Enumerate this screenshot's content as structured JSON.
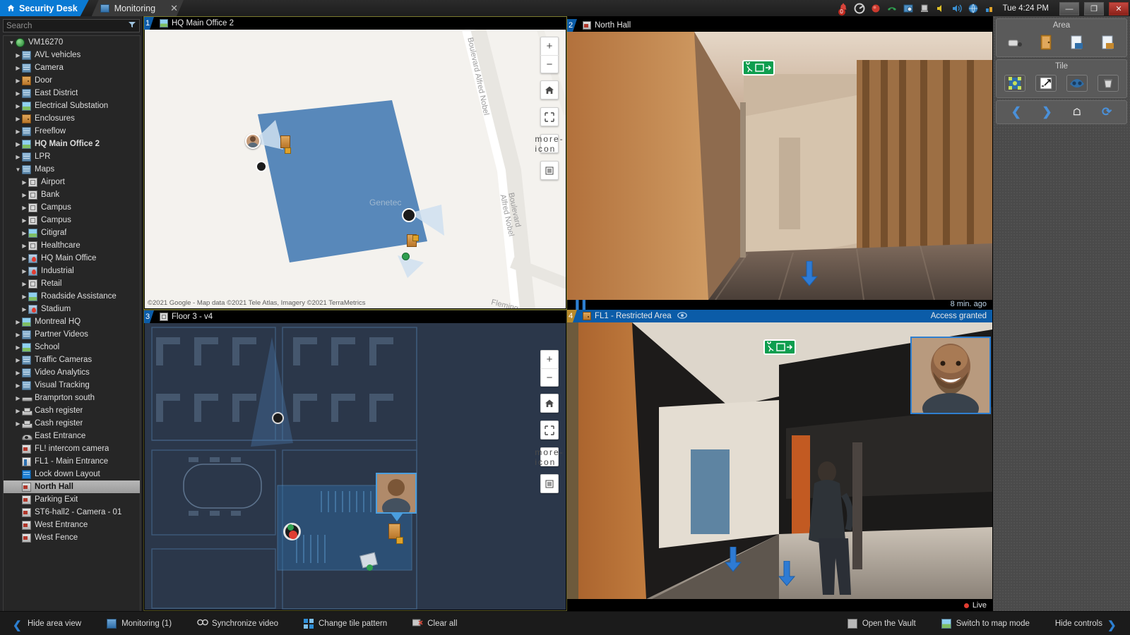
{
  "titlebar": {
    "app_tab": {
      "label": "Security Desk",
      "icon": "home-icon"
    },
    "doc_tab": {
      "label": "Monitoring",
      "icon": "monitoring-icon",
      "close": "✕"
    },
    "tray_icons": [
      "alarm-bell-icon",
      "genetec-logo-icon",
      "record-icon",
      "phone-icon",
      "task-icon",
      "hardware-icon",
      "mute-icon",
      "volume-icon",
      "network-globe-icon",
      "stats-icon"
    ],
    "alarm_count": "0",
    "clock": "Tue 4:24 PM",
    "window_buttons": {
      "minimize": "—",
      "restore": "❐",
      "close": "✕"
    }
  },
  "sidebar": {
    "search": {
      "placeholder": "Search",
      "value": "",
      "filter_icon": "filter-icon"
    },
    "tree": [
      {
        "label": "VM16270",
        "depth": 0,
        "arrow": "down",
        "icon": "vm-globe-icon",
        "bold": false,
        "selected": false
      },
      {
        "label": "AVL vehicles",
        "depth": 1,
        "arrow": "right",
        "icon": "ic-server",
        "bold": false,
        "selected": false
      },
      {
        "label": "Camera",
        "depth": 1,
        "arrow": "right",
        "icon": "ic-server",
        "bold": false,
        "selected": false
      },
      {
        "label": "Door",
        "depth": 1,
        "arrow": "right",
        "icon": "ic-door",
        "bold": false,
        "selected": false
      },
      {
        "label": "East District",
        "depth": 1,
        "arrow": "right",
        "icon": "ic-server",
        "bold": false,
        "selected": false
      },
      {
        "label": "Electrical Substation",
        "depth": 1,
        "arrow": "right",
        "icon": "ic-map",
        "bold": false,
        "selected": false
      },
      {
        "label": "Enclosures",
        "depth": 1,
        "arrow": "right",
        "icon": "ic-door",
        "bold": false,
        "selected": false
      },
      {
        "label": "Freeflow",
        "depth": 1,
        "arrow": "right",
        "icon": "ic-server",
        "bold": false,
        "selected": false
      },
      {
        "label": "HQ Main Office 2",
        "depth": 1,
        "arrow": "right",
        "icon": "ic-map",
        "bold": true,
        "selected": false
      },
      {
        "label": "LPR",
        "depth": 1,
        "arrow": "right",
        "icon": "ic-server",
        "bold": false,
        "selected": false
      },
      {
        "label": "Maps",
        "depth": 1,
        "arrow": "down",
        "icon": "ic-server",
        "bold": false,
        "selected": false
      },
      {
        "label": "Airport",
        "depth": 2,
        "arrow": "right",
        "icon": "ic-plan",
        "bold": false,
        "selected": false
      },
      {
        "label": "Bank",
        "depth": 2,
        "arrow": "right",
        "icon": "ic-plan",
        "bold": false,
        "selected": false
      },
      {
        "label": "Campus",
        "depth": 2,
        "arrow": "right",
        "icon": "ic-plan",
        "bold": false,
        "selected": false
      },
      {
        "label": "Campus",
        "depth": 2,
        "arrow": "right",
        "icon": "ic-plan",
        "bold": false,
        "selected": false
      },
      {
        "label": "Citigraf",
        "depth": 2,
        "arrow": "right",
        "icon": "ic-map",
        "bold": false,
        "selected": false
      },
      {
        "label": "Healthcare",
        "depth": 2,
        "arrow": "right",
        "icon": "ic-plan",
        "bold": false,
        "selected": false
      },
      {
        "label": "HQ Main Office",
        "depth": 2,
        "arrow": "right",
        "icon": "ic-mappin",
        "bold": false,
        "selected": false
      },
      {
        "label": "Industrial",
        "depth": 2,
        "arrow": "right",
        "icon": "ic-mappin",
        "bold": false,
        "selected": false
      },
      {
        "label": "Retail",
        "depth": 2,
        "arrow": "right",
        "icon": "ic-plan",
        "bold": false,
        "selected": false
      },
      {
        "label": "Roadside Assistance",
        "depth": 2,
        "arrow": "right",
        "icon": "ic-map",
        "bold": false,
        "selected": false
      },
      {
        "label": "Stadium",
        "depth": 2,
        "arrow": "right",
        "icon": "ic-mappin",
        "bold": false,
        "selected": false
      },
      {
        "label": "Montreal HQ",
        "depth": 1,
        "arrow": "right",
        "icon": "ic-map",
        "bold": false,
        "selected": false
      },
      {
        "label": "Partner Videos",
        "depth": 1,
        "arrow": "right",
        "icon": "ic-server",
        "bold": false,
        "selected": false
      },
      {
        "label": "School",
        "depth": 1,
        "arrow": "right",
        "icon": "ic-map",
        "bold": false,
        "selected": false
      },
      {
        "label": "Traffic Cameras",
        "depth": 1,
        "arrow": "right",
        "icon": "ic-server",
        "bold": false,
        "selected": false
      },
      {
        "label": "Video Analytics",
        "depth": 1,
        "arrow": "right",
        "icon": "ic-server",
        "bold": false,
        "selected": false
      },
      {
        "label": "Visual Tracking",
        "depth": 1,
        "arrow": "right",
        "icon": "ic-server",
        "bold": false,
        "selected": false
      },
      {
        "label": "Bramprton south",
        "depth": 1,
        "arrow": "right",
        "icon": "ic-lpr",
        "bold": false,
        "selected": false
      },
      {
        "label": "Cash register",
        "depth": 1,
        "arrow": "right",
        "icon": "ic-pos",
        "bold": false,
        "selected": false
      },
      {
        "label": "Cash register",
        "depth": 1,
        "arrow": "right",
        "icon": "ic-pos",
        "bold": false,
        "selected": false
      },
      {
        "label": "East Entrance",
        "depth": 1,
        "arrow": "none",
        "icon": "ic-dome",
        "bold": false,
        "selected": false
      },
      {
        "label": "FL! intercom camera",
        "depth": 1,
        "arrow": "none",
        "icon": "ic-cam",
        "bold": false,
        "selected": false
      },
      {
        "label": "FL1 - Main Entrance",
        "depth": 1,
        "arrow": "none",
        "icon": "ic-intercom",
        "bold": false,
        "selected": false
      },
      {
        "label": "Lock down Layout",
        "depth": 1,
        "arrow": "none",
        "icon": "ic-layout",
        "bold": false,
        "selected": false
      },
      {
        "label": "North Hall",
        "depth": 1,
        "arrow": "none",
        "icon": "ic-cam",
        "bold": true,
        "selected": true
      },
      {
        "label": "Parking Exit",
        "depth": 1,
        "arrow": "none",
        "icon": "ic-cam",
        "bold": false,
        "selected": false
      },
      {
        "label": "ST6-hall2 - Camera - 01",
        "depth": 1,
        "arrow": "none",
        "icon": "ic-cam",
        "bold": false,
        "selected": false
      },
      {
        "label": "West Entrance",
        "depth": 1,
        "arrow": "none",
        "icon": "ic-cam",
        "bold": false,
        "selected": false
      },
      {
        "label": "West Fence",
        "depth": 1,
        "arrow": "none",
        "icon": "ic-cam",
        "bold": false,
        "selected": false
      }
    ]
  },
  "tiles": {
    "tile1": {
      "number": "1",
      "title": "HQ Main Office 2",
      "icon": "map-icon",
      "attribution": "©2021 Google - Map data ©2021 Tele Atlas, Imagery ©2021 TerraMetrics",
      "road_labels": [
        "Boulevard Alfred Nobel",
        "Boulevard Alfred Nobel",
        "Fleming"
      ],
      "place_label": "Genetec",
      "controls": [
        "+",
        "−",
        "home-icon",
        "fit-icon",
        "more-icon",
        "layers-icon"
      ]
    },
    "tile2": {
      "number": "2",
      "title": "North Hall",
      "icon": "camera-icon",
      "timestamp": "8 min. ago",
      "playback_state": "paused"
    },
    "tile3": {
      "number": "3",
      "title": "Floor 3 - v4",
      "icon": "floorplan-icon",
      "controls": [
        "+",
        "−",
        "home-icon",
        "fit-icon",
        "more-icon",
        "layers-icon"
      ]
    },
    "tile4": {
      "number": "4",
      "title": "FL1 - Restricted Area",
      "icon": "door-icon",
      "related_icon": "linked-camera-icon",
      "status": "Access granted",
      "live_label": "Live"
    }
  },
  "right_panel": {
    "area": {
      "title": "Area",
      "buttons": [
        "area-cycle-icon",
        "area-door-icon",
        "area-report-in-icon",
        "area-report-out-icon"
      ]
    },
    "tile": {
      "title": "Tile",
      "buttons": [
        "digital-zoom-icon",
        "maximize-icon",
        "privacy-mask-icon",
        "clear-tile-icon"
      ]
    },
    "nav": [
      "back-icon",
      "forward-icon",
      "home-icon",
      "refresh-icon"
    ]
  },
  "bottombar": {
    "left": [
      {
        "label": "Hide area view",
        "icon": "chevron-left-icon"
      },
      {
        "label": "Monitoring (1)",
        "icon": "monitoring-icon"
      },
      {
        "label": "Synchronize video",
        "icon": "sync-icon"
      },
      {
        "label": "Change tile pattern",
        "icon": "tile-pattern-icon"
      },
      {
        "label": "Clear all",
        "icon": "clear-all-icon"
      }
    ],
    "right": [
      {
        "label": "Open the Vault",
        "icon": "vault-icon"
      },
      {
        "label": "Switch to map mode",
        "icon": "map-mode-icon"
      },
      {
        "label": "Hide controls",
        "icon": "chevron-right-icon"
      }
    ]
  },
  "colors": {
    "accent_blue": "#0a7ad4",
    "tile_header_blue": "#0b5ca8",
    "selected_tile_border": "#7a7a2f",
    "status_red": "#e03c31",
    "map_water": "#4a7fb5"
  }
}
